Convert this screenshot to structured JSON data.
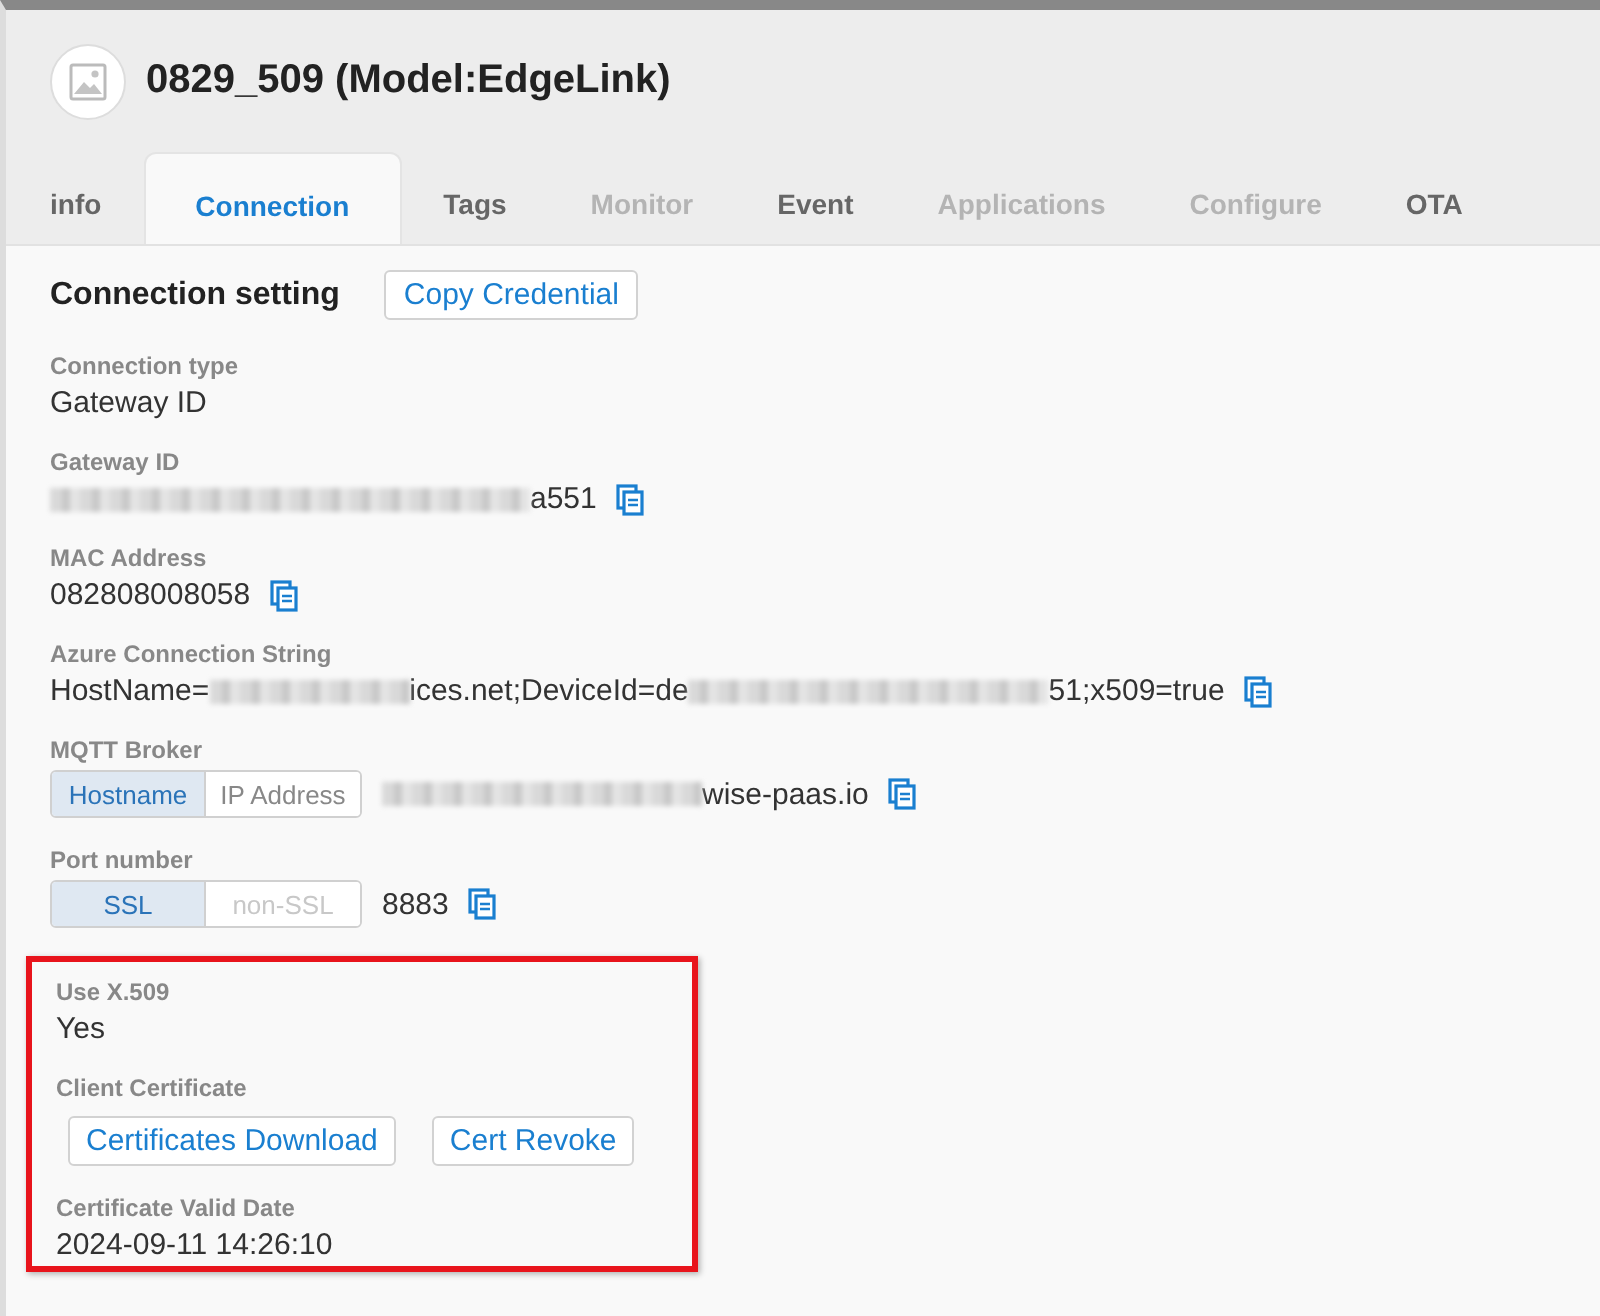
{
  "header": {
    "title": "0829_509 (Model:EdgeLink)"
  },
  "tabs": [
    {
      "label": "info",
      "selected": false,
      "disabled": false
    },
    {
      "label": "Connection",
      "selected": true,
      "disabled": false
    },
    {
      "label": "Tags",
      "selected": false,
      "disabled": false
    },
    {
      "label": "Monitor",
      "selected": false,
      "disabled": true
    },
    {
      "label": "Event",
      "selected": false,
      "disabled": false
    },
    {
      "label": "Applications",
      "selected": false,
      "disabled": true
    },
    {
      "label": "Configure",
      "selected": false,
      "disabled": true
    },
    {
      "label": "OTA",
      "selected": false,
      "disabled": false
    }
  ],
  "section": {
    "title": "Connection setting",
    "button": "Copy Credential"
  },
  "fields": [
    {
      "kind": "text",
      "label": "Connection type",
      "value": [
        {
          "kind": "text",
          "text": "Gateway ID"
        }
      ]
    },
    {
      "kind": "copy",
      "label": "Gateway ID",
      "value": [
        {
          "kind": "blur"
        },
        {
          "kind": "text",
          "text": "a551"
        }
      ]
    },
    {
      "kind": "copy",
      "label": "MAC Address",
      "value": [
        {
          "kind": "text",
          "text": "082808008058"
        }
      ]
    },
    {
      "kind": "copy",
      "label": "Azure Connection String",
      "value": [
        {
          "kind": "text",
          "text": "HostName="
        },
        {
          "kind": "blur"
        },
        {
          "kind": "text",
          "text": "ices.net;DeviceId=de"
        },
        {
          "kind": "blur"
        },
        {
          "kind": "text",
          "text": "51;x509=true"
        }
      ]
    },
    {
      "kind": "segmented",
      "label": "MQTT Broker",
      "options": [
        {
          "label": "Hostname",
          "selected": true,
          "disabled": false
        },
        {
          "label": "IP Address",
          "selected": false,
          "disabled": false
        }
      ],
      "value": [
        {
          "kind": "blur"
        },
        {
          "kind": "text",
          "text": "wise-paas.io"
        }
      ]
    },
    {
      "kind": "segmented",
      "label": "Port number",
      "options": [
        {
          "label": "SSL",
          "selected": true,
          "disabled": false
        },
        {
          "label": "non-SSL",
          "selected": false,
          "disabled": true
        }
      ],
      "value": [
        {
          "kind": "text",
          "text": "8883"
        }
      ]
    }
  ],
  "certificate": {
    "highlighted": true,
    "use_label": "Use X.509",
    "use_value": "Yes",
    "client_label": "Client Certificate",
    "buttons": [
      "Certificates Download",
      "Cert Revoke"
    ],
    "date_label": "Certificate Valid Date",
    "date_value": "2024-09-11 14:26:10"
  }
}
